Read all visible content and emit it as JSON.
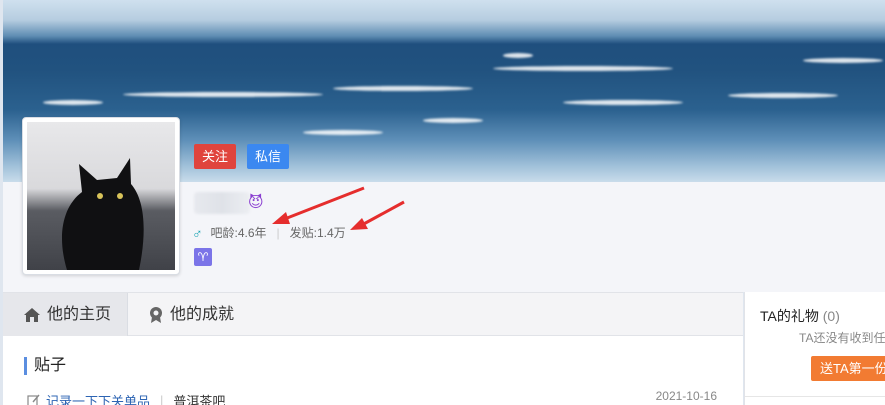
{
  "header": {
    "follow_label": "关注",
    "message_label": "私信",
    "user_emoji": "😈",
    "bar_age": "吧龄:4.6年",
    "post_count": "发贴:1.4万",
    "zodiac": "♈"
  },
  "tabs": [
    {
      "label": "他的主页",
      "icon": "home-icon"
    },
    {
      "label": "他的成就",
      "icon": "medal-icon"
    }
  ],
  "main": {
    "section_title": "贴子",
    "posts": [
      {
        "title": "记录一下下关单品",
        "forum": "普洱茶吧",
        "date": "2021-10-16"
      }
    ]
  },
  "sidebar": {
    "gift_title": "TA的礼物",
    "gift_count": "(0)",
    "gift_empty": "TA还没有收到任",
    "gift_button": "送TA第一份礼"
  },
  "colors": {
    "follow": "#e0443d",
    "message": "#3b88f0",
    "link": "#2d64b3",
    "gift_button": "#f27b32",
    "annotation_arrow": "#e52d2d"
  }
}
